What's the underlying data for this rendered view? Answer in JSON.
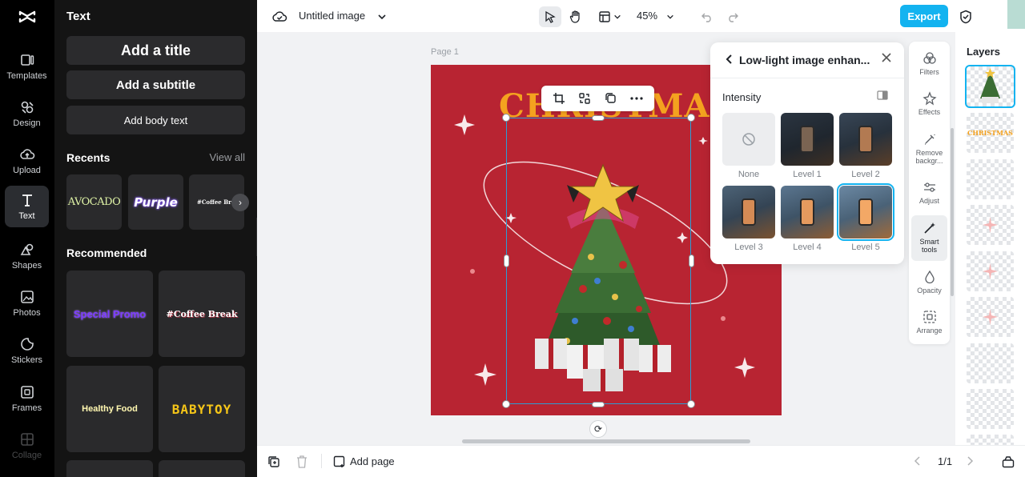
{
  "rail": {
    "items": [
      {
        "label": "Templates"
      },
      {
        "label": "Design"
      },
      {
        "label": "Upload"
      },
      {
        "label": "Text"
      },
      {
        "label": "Shapes"
      },
      {
        "label": "Photos"
      },
      {
        "label": "Stickers"
      },
      {
        "label": "Frames"
      },
      {
        "label": "Collage"
      }
    ]
  },
  "panel": {
    "title": "Text",
    "add_title": "Add a title",
    "add_subtitle": "Add a subtitle",
    "add_body": "Add body text",
    "recents_label": "Recents",
    "view_all": "View all",
    "recents": [
      "AVOCADO",
      "Purple",
      "#Coffee Break"
    ],
    "recommended_label": "Recommended",
    "recommended": [
      "Special Promo",
      "#Coffee Break",
      "Healthy Food",
      "BABYTOY"
    ]
  },
  "topbar": {
    "doc_title": "Untitled image",
    "zoom": "45%",
    "export_label": "Export"
  },
  "canvas": {
    "page_label": "Page 1",
    "headline": "CHRISTMAS"
  },
  "popup": {
    "title": "Low-light image enhan...",
    "intensity_label": "Intensity",
    "levels": [
      "None",
      "Level 1",
      "Level 2",
      "Level 3",
      "Level 4",
      "Level 5"
    ],
    "selected_level": "Level 5"
  },
  "tools": {
    "items": [
      {
        "label": "Filters"
      },
      {
        "label": "Effects"
      },
      {
        "label": "Remove backgr..."
      },
      {
        "label": "Adjust"
      },
      {
        "label": "Smart tools"
      },
      {
        "label": "Opacity"
      },
      {
        "label": "Arrange"
      }
    ]
  },
  "layers": {
    "title": "Layers",
    "thumb_text": "CHRISTMAS"
  },
  "bottombar": {
    "add_page_label": "Add page",
    "page_count": "1/1"
  },
  "colors": {
    "accent": "#13b3f0",
    "artboard": "#b82432",
    "headline": "#f4a21f",
    "panel_bg": "#141414"
  }
}
